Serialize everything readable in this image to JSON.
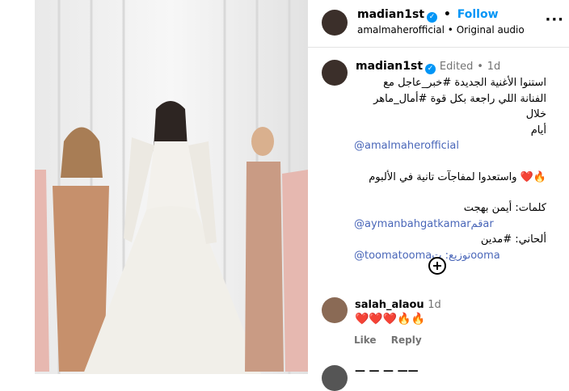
{
  "header": {
    "username": "madian1st",
    "separator": "•",
    "follow_label": "Follow",
    "audio": "amalmaherofficial • Original audio",
    "more": "···"
  },
  "caption": {
    "username": "madian1st",
    "edited": "Edited",
    "time_sep": "•",
    "time": "1d",
    "lines": [
      "استنوا الأغنية الجديدة #خبر_عاجل مع",
      "الفنانة اللي راجعة بكل قوة #أمال_ماهر خلال",
      "أيام",
      "@amalmaherofficial",
      "",
      "🔥❤️ واستعدوا لمفاجآت تانية في الألبوم",
      "",
      "كلمات: أيمن بهجت",
      "@aymanbahgatkamarقمar",
      "ألحاني: #مدين",
      "@toomatoomaتوزيع: تooma"
    ]
  },
  "comments": [
    {
      "username": "salah_alaou",
      "time": "1d",
      "text": "❤️❤️❤️🔥🔥",
      "like_label": "Like",
      "reply_label": "Reply"
    }
  ],
  "second_comment_partial": "— — — ——"
}
